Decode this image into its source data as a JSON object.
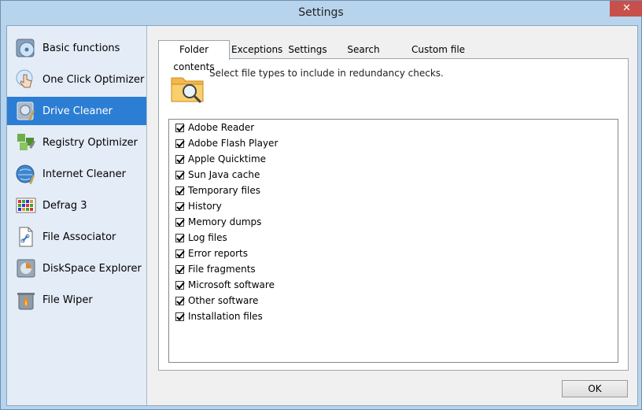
{
  "window": {
    "title": "Settings"
  },
  "sidebar": {
    "items": [
      {
        "label": "Basic functions",
        "icon": "disc-icon",
        "active": false
      },
      {
        "label": "One Click Optimizer",
        "icon": "hand-click-icon",
        "active": false
      },
      {
        "label": "Drive Cleaner",
        "icon": "drive-broom-icon",
        "active": true
      },
      {
        "label": "Registry Optimizer",
        "icon": "registry-blocks-icon",
        "active": false
      },
      {
        "label": "Internet Cleaner",
        "icon": "globe-broom-icon",
        "active": false
      },
      {
        "label": "Defrag 3",
        "icon": "defrag-grid-icon",
        "active": false
      },
      {
        "label": "File Associator",
        "icon": "file-link-icon",
        "active": false
      },
      {
        "label": "DiskSpace Explorer",
        "icon": "disk-chart-icon",
        "active": false
      },
      {
        "label": "File Wiper",
        "icon": "trash-fire-icon",
        "active": false
      }
    ]
  },
  "tabs": [
    {
      "label": "Folder contents",
      "active": true
    },
    {
      "label": "Exceptions",
      "active": false
    },
    {
      "label": "Settings",
      "active": false
    },
    {
      "label": "Search drives",
      "active": false
    },
    {
      "label": "Custom file filters",
      "active": false
    }
  ],
  "panel": {
    "description": "Select file types to include in redundancy checks.",
    "icon": "folder-search-icon",
    "file_types": [
      {
        "label": "Adobe Reader",
        "checked": true
      },
      {
        "label": "Adobe Flash Player",
        "checked": true
      },
      {
        "label": "Apple Quicktime",
        "checked": true
      },
      {
        "label": "Sun Java cache",
        "checked": true
      },
      {
        "label": "Temporary files",
        "checked": true
      },
      {
        "label": "History",
        "checked": true
      },
      {
        "label": "Memory dumps",
        "checked": true
      },
      {
        "label": "Log files",
        "checked": true
      },
      {
        "label": "Error reports",
        "checked": true
      },
      {
        "label": "File fragments",
        "checked": true
      },
      {
        "label": "Microsoft software",
        "checked": true
      },
      {
        "label": "Other software",
        "checked": true
      },
      {
        "label": "Installation files",
        "checked": true
      }
    ]
  },
  "buttons": {
    "ok_label": "OK",
    "close_glyph": "✕"
  },
  "colors": {
    "accent": "#2b7ed3",
    "close": "#c7504a",
    "folder": "#f2b84b"
  }
}
